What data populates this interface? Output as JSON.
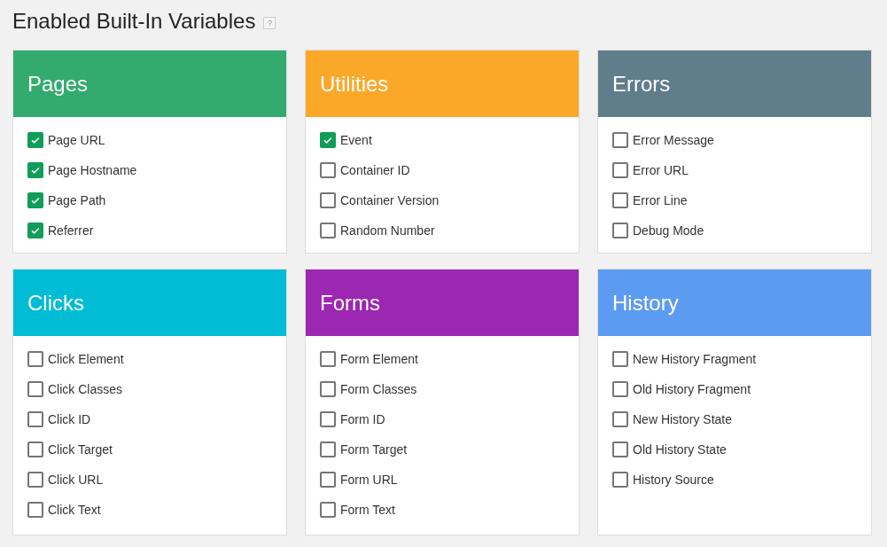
{
  "page": {
    "title": "Enabled Built-In Variables",
    "help_label": "?"
  },
  "panels": [
    {
      "title": "Pages",
      "color": "#33ab6e",
      "items": [
        {
          "label": "Page URL",
          "checked": true
        },
        {
          "label": "Page Hostname",
          "checked": true
        },
        {
          "label": "Page Path",
          "checked": true
        },
        {
          "label": "Referrer",
          "checked": true
        }
      ]
    },
    {
      "title": "Utilities",
      "color": "#fba829",
      "items": [
        {
          "label": "Event",
          "checked": true
        },
        {
          "label": "Container ID",
          "checked": false
        },
        {
          "label": "Container Version",
          "checked": false
        },
        {
          "label": "Random Number",
          "checked": false
        }
      ]
    },
    {
      "title": "Errors",
      "color": "#607d8b",
      "items": [
        {
          "label": "Error Message",
          "checked": false
        },
        {
          "label": "Error URL",
          "checked": false
        },
        {
          "label": "Error Line",
          "checked": false
        },
        {
          "label": "Debug Mode",
          "checked": false
        }
      ]
    },
    {
      "title": "Clicks",
      "color": "#00bcd4",
      "items": [
        {
          "label": "Click Element",
          "checked": false
        },
        {
          "label": "Click Classes",
          "checked": false
        },
        {
          "label": "Click ID",
          "checked": false
        },
        {
          "label": "Click Target",
          "checked": false
        },
        {
          "label": "Click URL",
          "checked": false
        },
        {
          "label": "Click Text",
          "checked": false
        }
      ]
    },
    {
      "title": "Forms",
      "color": "#9c27b0",
      "items": [
        {
          "label": "Form Element",
          "checked": false
        },
        {
          "label": "Form Classes",
          "checked": false
        },
        {
          "label": "Form ID",
          "checked": false
        },
        {
          "label": "Form Target",
          "checked": false
        },
        {
          "label": "Form URL",
          "checked": false
        },
        {
          "label": "Form Text",
          "checked": false
        }
      ]
    },
    {
      "title": "History",
      "color": "#5c9bf2",
      "items": [
        {
          "label": "New History Fragment",
          "checked": false
        },
        {
          "label": "Old History Fragment",
          "checked": false
        },
        {
          "label": "New History State",
          "checked": false
        },
        {
          "label": "Old History State",
          "checked": false
        },
        {
          "label": "History Source",
          "checked": false
        }
      ]
    }
  ]
}
